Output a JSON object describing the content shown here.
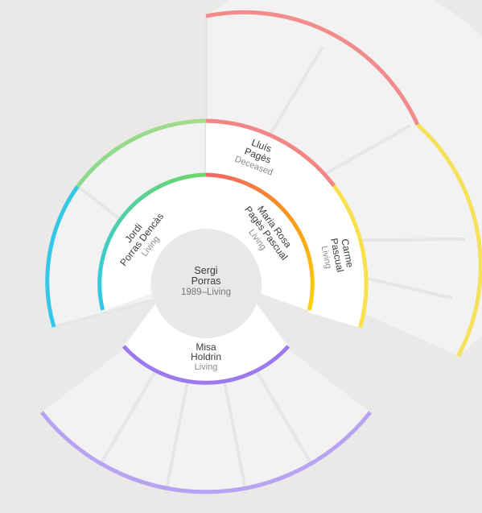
{
  "chart_data": {
    "type": "fan-chart",
    "root": {
      "first_name": "Sergi",
      "last_name": "Porras",
      "status": "1989–Living"
    },
    "people": [
      {
        "id": "father",
        "first_name": "Jordi",
        "last_name": "Porras Dencàs",
        "status": "Living"
      },
      {
        "id": "mother",
        "first_name": "Maria Rosa",
        "last_name": "Pagès Pascual",
        "status": "Living"
      },
      {
        "id": "mother-father",
        "first_name": "Lluís",
        "last_name": "Pagès",
        "status": "Deceased"
      },
      {
        "id": "mother-mother",
        "first_name": "Carme",
        "last_name": "Pascual",
        "status": "Living"
      },
      {
        "id": "spouse",
        "first_name": "Misa",
        "last_name": "Holdrin",
        "status": "Living"
      }
    ]
  },
  "colors": {
    "background": "#ebe9e7",
    "empty_slot": "#f2f2f2",
    "card": "#ffffff",
    "paternal_gradient": [
      "#2ec9e8",
      "#6dd98a",
      "#a3dd8c"
    ],
    "maternal_gradient": [
      "#f2656a",
      "#f7931e",
      "#fdd20a"
    ],
    "grandfather_arc": "#f28b8b",
    "grandmother_arc": "#f6e15a",
    "spouse_arc": "#9b7af0",
    "descendant_arc": "#b8a3f3"
  }
}
